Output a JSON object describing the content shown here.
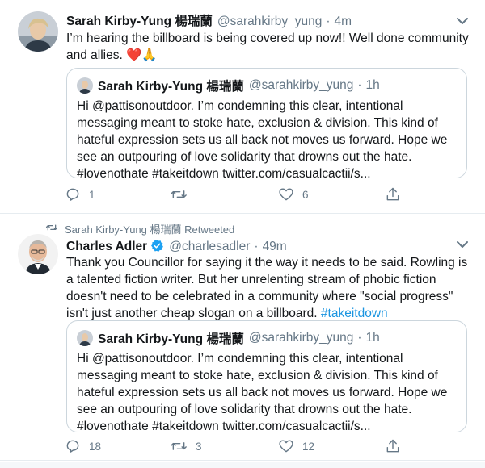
{
  "tweet1": {
    "author_name": "Sarah Kirby-Yung 楊瑞蘭",
    "author_handle": "@sarahkirby_yung",
    "time": "4m",
    "text": "I’m hearing the billboard is being covered up now!! Well done community and allies.",
    "emojis": "❤️🙏",
    "quote": {
      "author_name": "Sarah Kirby-Yung 楊瑞蘭",
      "author_handle": "@sarahkirby_yung",
      "time": "1h",
      "text": "Hi @pattisonoutdoor. I’m condemning this clear, intentional messaging meant to stoke hate, exclusion & division. This kind of hateful expression sets us all back not moves us forward. Hope we see an outpouring of love  solidarity that drowns out the hate. #lovenothate #takeitdown twitter.com/casualcactii/s..."
    },
    "reply_count": "1",
    "retweet_count": "",
    "like_count": "6"
  },
  "tweet2": {
    "retweet_context": "Sarah Kirby-Yung 楊瑞蘭 Retweeted",
    "author_name": "Charles Adler",
    "author_handle": "@charlesadler",
    "time": "49m",
    "text": "Thank you Councillor for saying it the way it needs to be said. Rowling is a talented fiction writer. But her unrelenting stream of phobic fiction doesn't need to be celebrated in a community where \"social progress\" isn't just another cheap slogan on a billboard.",
    "hashtag": "#takeitdown",
    "quote": {
      "author_name": "Sarah Kirby-Yung 楊瑞蘭",
      "author_handle": "@sarahkirby_yung",
      "time": "1h",
      "text": "Hi @pattisonoutdoor. I’m condemning this clear, intentional messaging meant to stoke hate, exclusion & division. This kind of hateful expression sets us all back not moves us forward. Hope we see an outpouring of love  solidarity that drowns out the hate. #lovenothate #takeitdown twitter.com/casualcactii/s..."
    },
    "reply_count": "18",
    "retweet_count": "3",
    "like_count": "12"
  },
  "colors": {
    "secondary_text": "#657786",
    "link": "#1b95e0",
    "border": "#ccd6dd",
    "verified": "#1da1f2"
  },
  "icons": {
    "reply": "reply-icon",
    "retweet": "retweet-icon",
    "like": "heart-icon",
    "share": "share-icon",
    "caret": "chevron-down-icon",
    "verified": "verified-badge-icon"
  }
}
